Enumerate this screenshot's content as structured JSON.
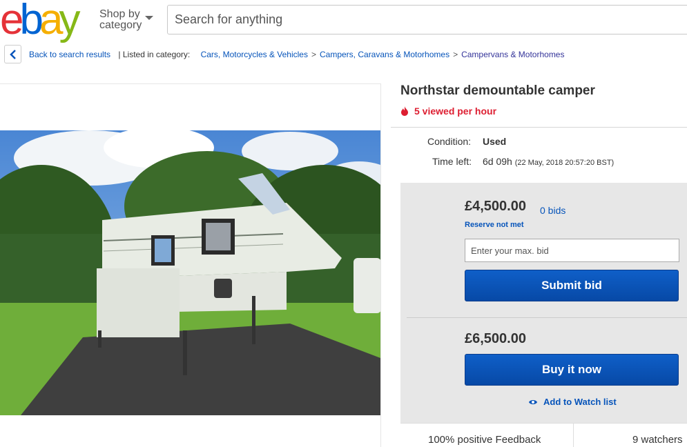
{
  "header": {
    "logo_letters": [
      {
        "char": "e",
        "color": "#e53238"
      },
      {
        "char": "b",
        "color": "#0064d2"
      },
      {
        "char": "a",
        "color": "#f5af02"
      },
      {
        "char": "y",
        "color": "#86b817"
      }
    ],
    "shop_by_line1": "Shop by",
    "shop_by_line2": "category",
    "search_placeholder": "Search for anything"
  },
  "breadcrumb": {
    "back_label": "Back to search results",
    "listed_label": "| Listed in category:",
    "items": [
      "Cars, Motorcycles & Vehicles",
      "Campers, Caravans & Motorhomes",
      "Campervans & Motorhomes"
    ],
    "separator": ">"
  },
  "listing": {
    "title": "Northstar demountable camper",
    "views_text": "5 viewed per hour",
    "condition_label": "Condition:",
    "condition_value": "Used",
    "time_left_label": "Time left:",
    "time_left_value": "6d 09h",
    "time_left_detail": "(22 May, 2018  20:57:20 BST)"
  },
  "bid": {
    "current_price": "£4,500.00",
    "bid_count": "0 bids",
    "reserve_status": "Reserve not met",
    "max_bid_placeholder": "Enter your max. bid",
    "submit_label": "Submit bid",
    "buy_now_price": "£6,500.00",
    "buy_now_label": "Buy it now",
    "watch_label": "Add to Watch list",
    "feedback": "100% positive Feedback",
    "watchers": "9 watchers"
  },
  "colors": {
    "link_blue": "#0654ba",
    "button_blue": "#0654ba",
    "hot_red": "#dd1e31"
  }
}
